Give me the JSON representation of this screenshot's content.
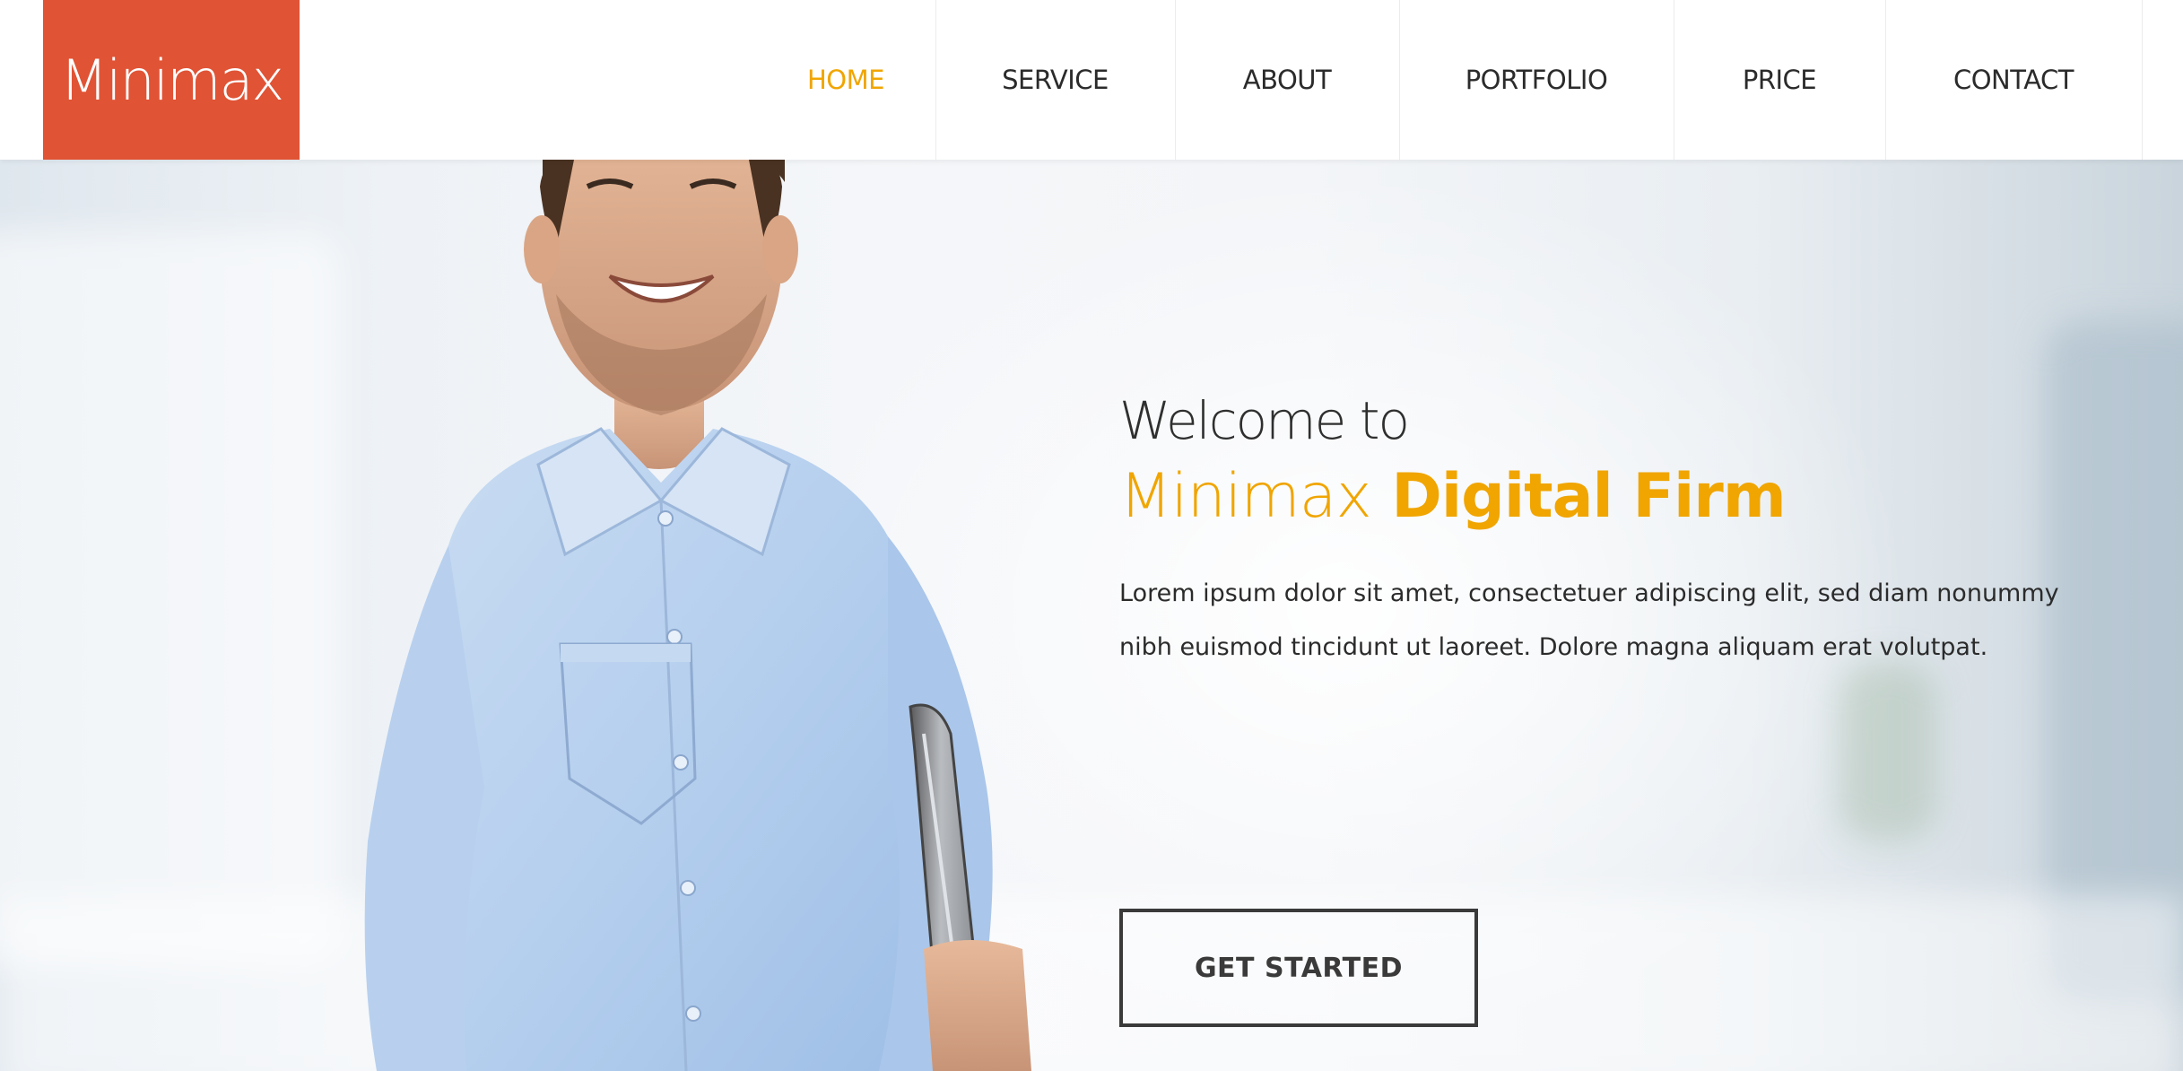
{
  "brand": {
    "logo_text": "Minimax",
    "logo_color": "#e05335",
    "accent_color": "#f0a500"
  },
  "nav": {
    "items": [
      {
        "label": "HOME",
        "active": true
      },
      {
        "label": "SERVICE",
        "active": false
      },
      {
        "label": "ABOUT",
        "active": false
      },
      {
        "label": "PORTFOLIO",
        "active": false
      },
      {
        "label": "PRICE",
        "active": false
      },
      {
        "label": "CONTACT",
        "active": false
      }
    ]
  },
  "hero": {
    "welcome": "Welcome to",
    "brand_light": "Minimax",
    "brand_bold": "Digital Firm",
    "lead": "Lorem ipsum dolor sit amet, consectetuer adipiscing elit, sed diam nonummy nibh euismod tincidunt ut laoreet. Dolore magna aliquam erat volutpat.",
    "cta_label": "GET STARTED",
    "image_subject": "smiling-man-holding-laptop"
  }
}
